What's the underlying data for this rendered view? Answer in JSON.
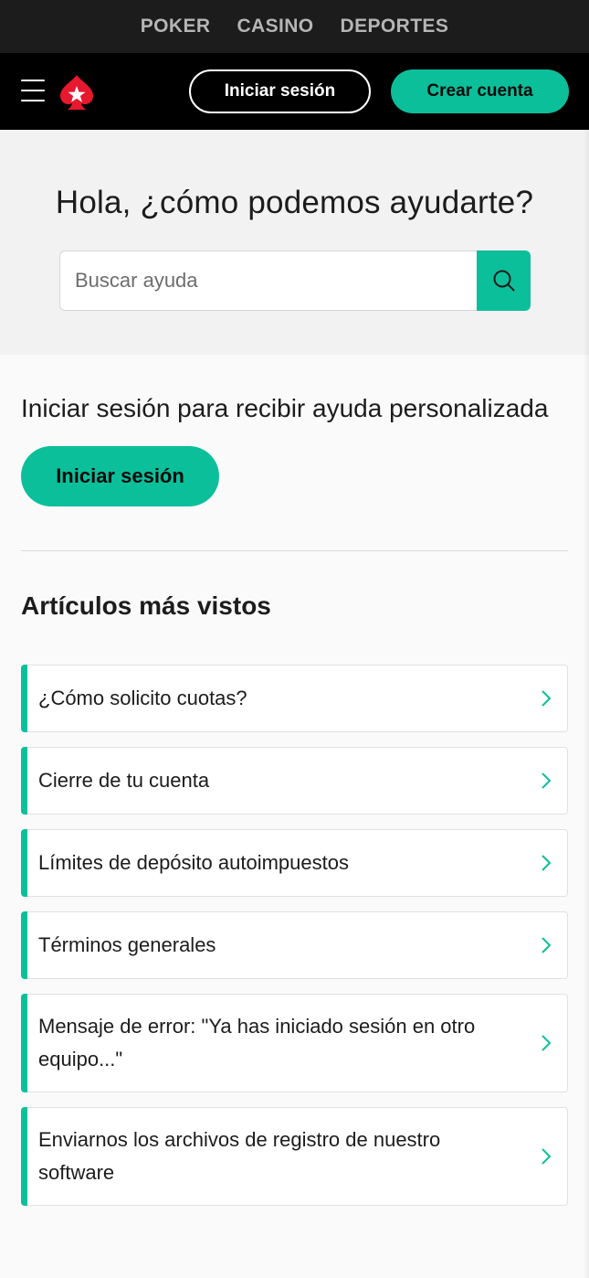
{
  "brand_nav": {
    "items": [
      "POKER",
      "CASINO",
      "DEPORTES"
    ]
  },
  "header": {
    "menu_icon": "hamburger-menu-icon",
    "logo_icon": "pokerstars-spade-star-logo",
    "login_label": "Iniciar sesión",
    "signup_label": "Crear cuenta"
  },
  "hero": {
    "title": "Hola, ¿cómo podemos ayudarte?",
    "search_placeholder": "Buscar ayuda",
    "search_value": "",
    "search_icon": "search-icon"
  },
  "signin": {
    "title": "Iniciar sesión para recibir ayuda personalizada",
    "button_label": "Iniciar sesión"
  },
  "articles": {
    "title": "Artículos más vistos",
    "items": [
      "¿Cómo solicito cuotas?",
      "Cierre de tu cuenta",
      "Límites de depósito autoimpuestos",
      "Términos generales",
      "Mensaje de error: \"Ya has iniciado sesión en otro equipo...\"",
      "Enviarnos los archivos de registro de nuestro software"
    ]
  },
  "colors": {
    "accent": "#0cbf9b",
    "header_bg": "#000000",
    "brand_bar_bg": "#1c1c1c",
    "logo_red": "#e6192e"
  }
}
